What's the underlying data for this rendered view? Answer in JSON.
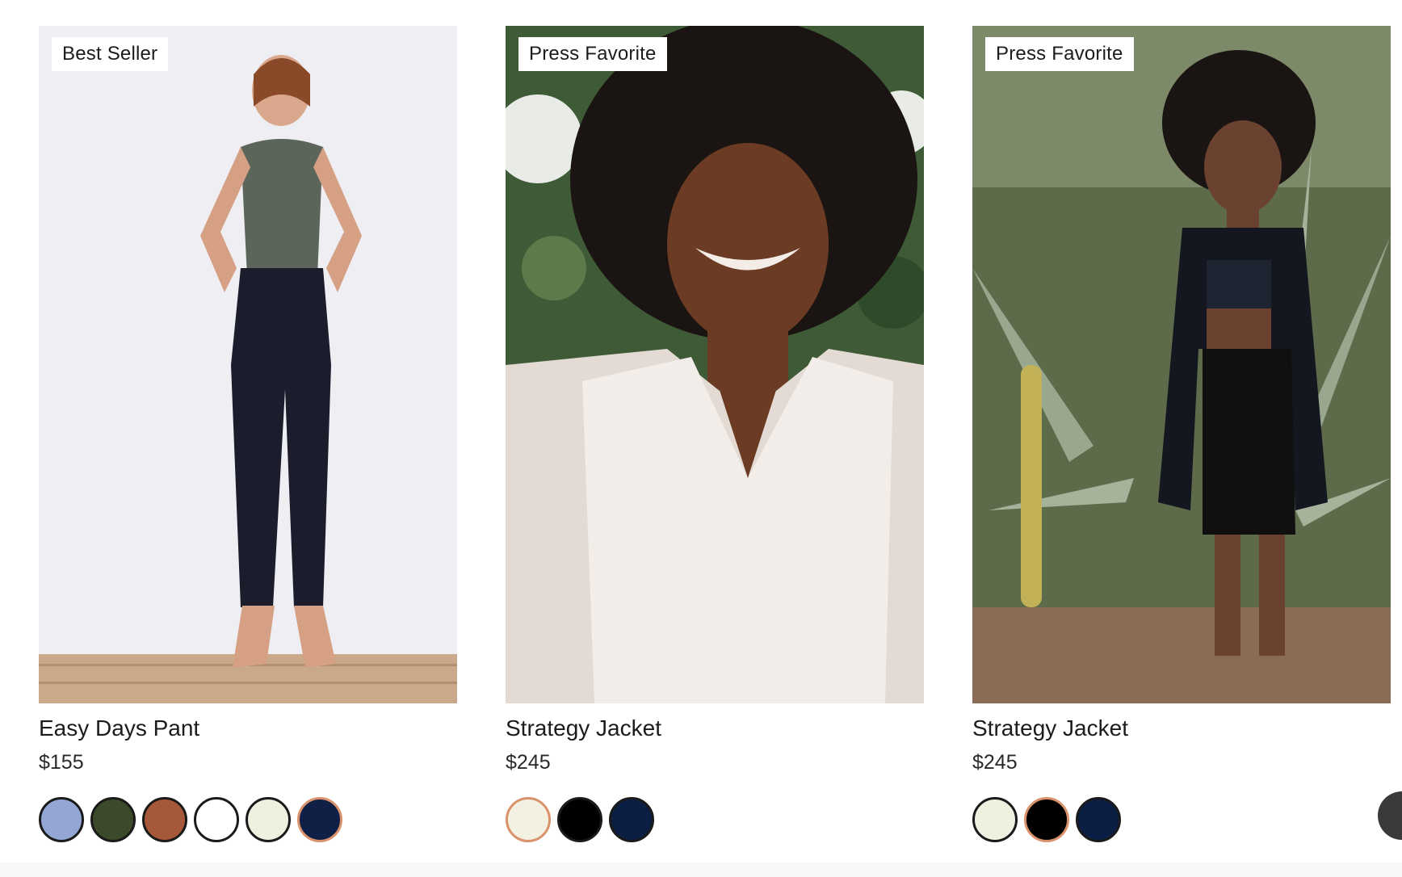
{
  "products": [
    {
      "badge": "Best Seller",
      "name": "Easy Days Pant",
      "price": "$155",
      "swatches": [
        "#93a6d4",
        "#3a4a2a",
        "#a5583a",
        "#ffffff",
        "#eef0e0",
        "#0f1f45"
      ],
      "selected_swatch": 5
    },
    {
      "badge": "Press Favorite",
      "name": "Strategy Jacket",
      "price": "$245",
      "swatches": [
        "#f3f1e2",
        "#000000",
        "#0b1f45"
      ],
      "selected_swatch": 0
    },
    {
      "badge": "Press Favorite",
      "name": "Strategy Jacket",
      "price": "$245",
      "swatches": [
        "#eef0e0",
        "#000000",
        "#0b1f45"
      ],
      "selected_swatch": 1
    }
  ],
  "colors": {
    "selected_swatch_ring": "#d9926b",
    "swatch_ring": "#1a1a1a"
  }
}
